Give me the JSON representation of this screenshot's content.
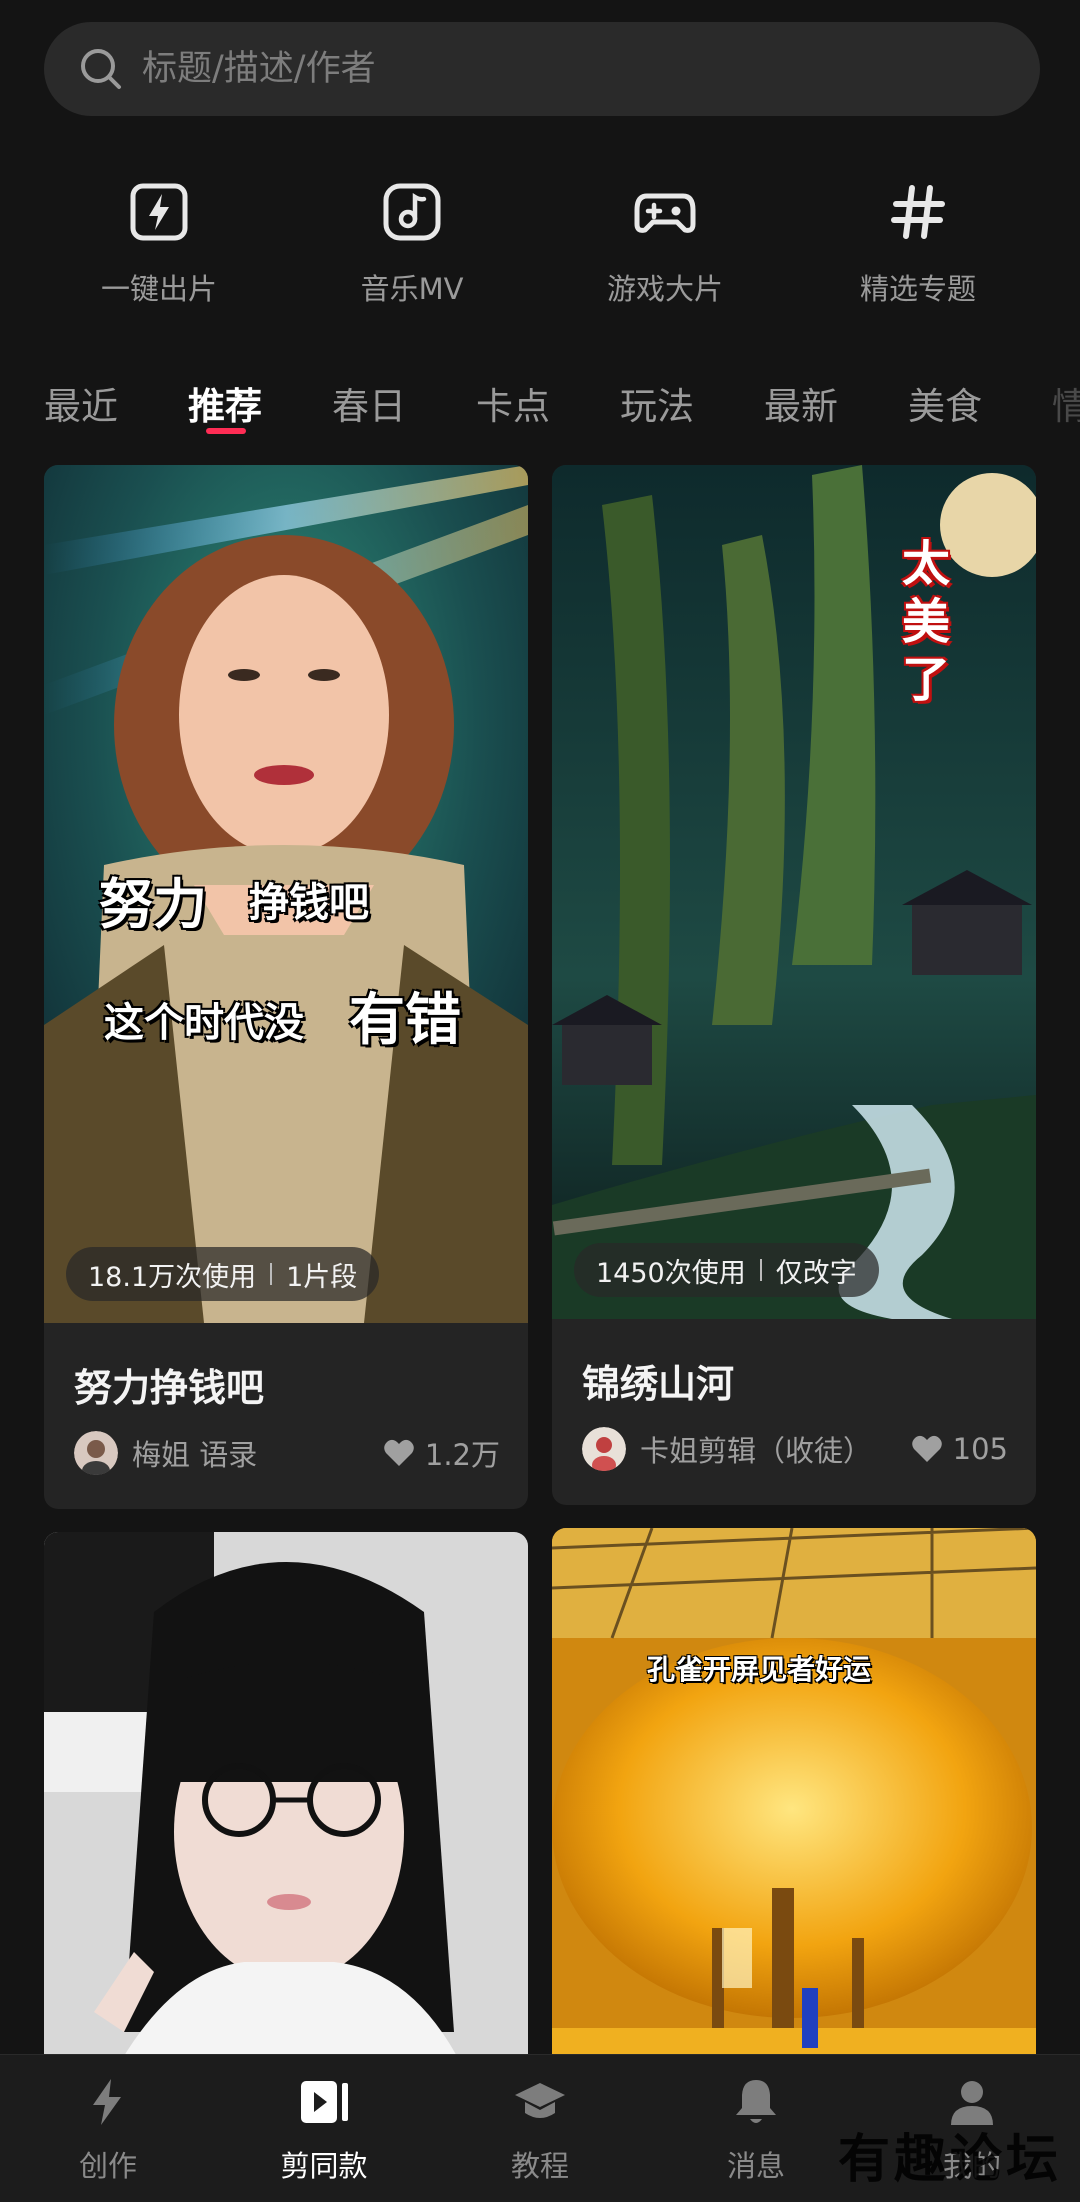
{
  "search": {
    "placeholder": "标题/描述/作者"
  },
  "quick_actions": [
    {
      "label": "一键出片",
      "icon": "flash-icon"
    },
    {
      "label": "音乐MV",
      "icon": "music-note-icon"
    },
    {
      "label": "游戏大片",
      "icon": "gamepad-icon"
    },
    {
      "label": "精选专题",
      "icon": "hashtag-icon"
    }
  ],
  "tabs": [
    "最近",
    "推荐",
    "春日",
    "卡点",
    "玩法",
    "最新",
    "美食",
    "情"
  ],
  "active_tab": "推荐",
  "accent_color": "#ff2d55",
  "cards": [
    {
      "usage": "18.1万次使用",
      "segments": "1片段",
      "title": "努力挣钱吧",
      "author": "梅姐 语录",
      "likes": "1.2万",
      "overlay_line1a": "努力",
      "overlay_line1b": "挣钱吧",
      "overlay_line2a": "这个时代没",
      "overlay_line2b": "有错"
    },
    {
      "usage": "1450次使用",
      "segments": "仅改字",
      "title": "锦绣山河",
      "author": "卡姐剪辑（收徒）",
      "likes": "105",
      "overlay_vertical": "太美了"
    },
    {
      "overlay": ""
    },
    {
      "overlay": "孔雀开屏见者好运"
    }
  ],
  "bottom_nav": [
    {
      "label": "创作",
      "icon": "lightning-icon"
    },
    {
      "label": "剪同款",
      "icon": "template-play-icon"
    },
    {
      "label": "教程",
      "icon": "graduation-cap-icon"
    },
    {
      "label": "消息",
      "icon": "bell-icon"
    },
    {
      "label": "我的",
      "icon": "person-icon"
    }
  ],
  "active_nav": "剪同款",
  "watermark": "有趣论坛"
}
